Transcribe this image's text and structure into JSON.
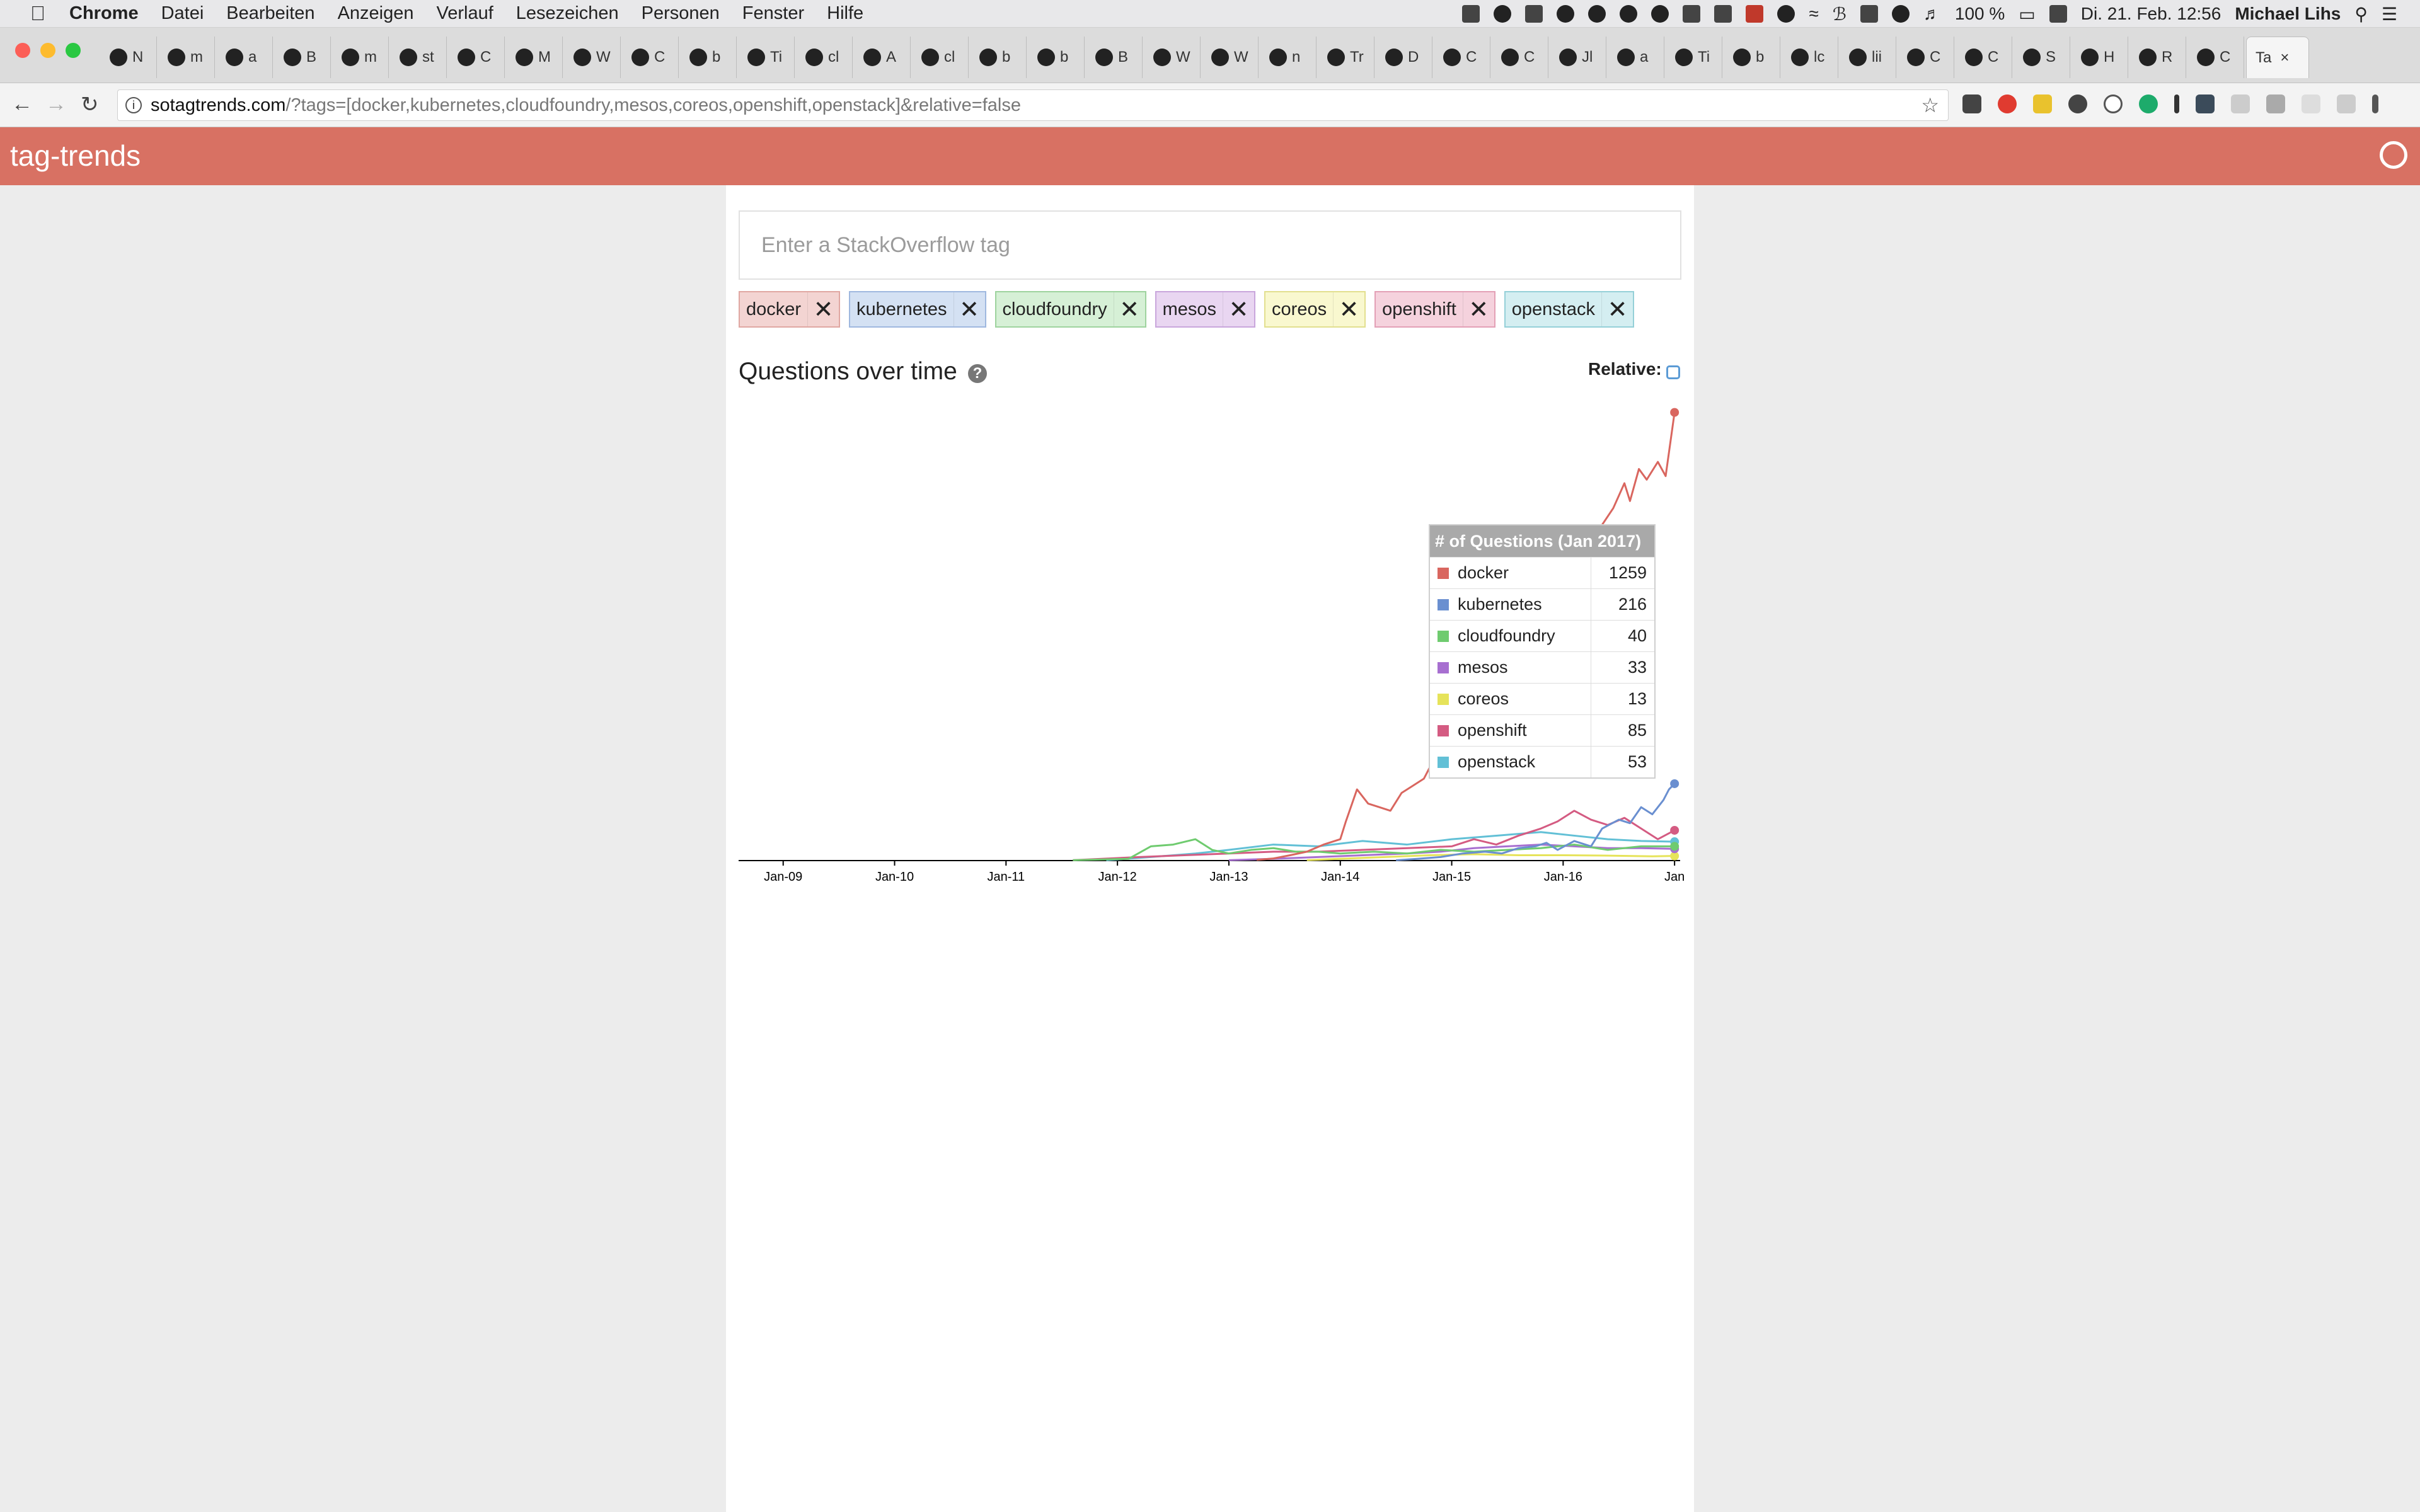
{
  "menubar": {
    "apple": "",
    "app": "Chrome",
    "items": [
      "Datei",
      "Bearbeiten",
      "Anzeigen",
      "Verlauf",
      "Lesezeichen",
      "Personen",
      "Fenster",
      "Hilfe"
    ],
    "battery": "100 %",
    "datetime": "Di. 21. Feb. 12:56",
    "user": "Michael Lihs"
  },
  "tabs": [
    "N",
    "m",
    "a",
    "B",
    "m",
    "st",
    "C",
    "M",
    "W",
    "C",
    "b",
    "Ti",
    "cl",
    "A",
    "cl",
    "b",
    "b",
    "B",
    "W",
    "W",
    "n",
    "Tr",
    "D",
    "C",
    "C",
    "Jl",
    "a",
    "Ti",
    "b",
    "lc",
    "lii",
    "C",
    "C",
    "S",
    "H",
    "R",
    "C"
  ],
  "active_tab": "Ta",
  "url": {
    "host": "sotagtrends.com",
    "path": "/?tags=[docker,kubernetes,cloudfoundry,mesos,coreos,openshift,openstack]&relative=false"
  },
  "app": {
    "brand": "tag-trends",
    "search_placeholder": "Enter a StackOverflow tag"
  },
  "tags": [
    {
      "name": "docker",
      "bg": "#f3d4d2",
      "border": "#e0a7a2"
    },
    {
      "name": "kubernetes",
      "bg": "#d4e1f3",
      "border": "#9fb8df"
    },
    {
      "name": "cloudfoundry",
      "bg": "#d6f0d6",
      "border": "#9ed39e"
    },
    {
      "name": "mesos",
      "bg": "#e9d6f1",
      "border": "#c9a6dc"
    },
    {
      "name": "coreos",
      "bg": "#f9f8cf",
      "border": "#e2df8f"
    },
    {
      "name": "openshift",
      "bg": "#f5d2dd",
      "border": "#e3a0b6"
    },
    {
      "name": "openstack",
      "bg": "#d4eef1",
      "border": "#95d0d8"
    }
  ],
  "chart_title": "Questions over time",
  "relative_label": "Relative:",
  "tooltip": {
    "title": "# of Questions (Jan 2017)"
  },
  "chart_data": {
    "type": "line",
    "x_ticks": [
      "Jan-09",
      "Jan-10",
      "Jan-11",
      "Jan-12",
      "Jan-13",
      "Jan-14",
      "Jan-15",
      "Jan-16",
      "Jan"
    ],
    "x_range": [
      2008.6,
      2017.05
    ],
    "y_range": [
      0,
      1260
    ],
    "series": [
      {
        "name": "docker",
        "color": "#d9665f",
        "points": [
          [
            2013.25,
            2
          ],
          [
            2013.4,
            6
          ],
          [
            2013.55,
            15
          ],
          [
            2013.7,
            25
          ],
          [
            2013.85,
            45
          ],
          [
            2014.0,
            60
          ],
          [
            2014.05,
            110
          ],
          [
            2014.15,
            200
          ],
          [
            2014.25,
            160
          ],
          [
            2014.35,
            150
          ],
          [
            2014.45,
            140
          ],
          [
            2014.55,
            190
          ],
          [
            2014.65,
            210
          ],
          [
            2014.75,
            230
          ],
          [
            2014.85,
            290
          ],
          [
            2014.92,
            250
          ],
          [
            2015.0,
            330
          ],
          [
            2015.1,
            390
          ],
          [
            2015.2,
            470
          ],
          [
            2015.3,
            520
          ],
          [
            2015.4,
            590
          ],
          [
            2015.5,
            560
          ],
          [
            2015.6,
            580
          ],
          [
            2015.7,
            640
          ],
          [
            2015.8,
            700
          ],
          [
            2015.9,
            760
          ],
          [
            2016.0,
            820
          ],
          [
            2016.15,
            860
          ],
          [
            2016.3,
            920
          ],
          [
            2016.45,
            990
          ],
          [
            2016.55,
            1060
          ],
          [
            2016.6,
            1010
          ],
          [
            2016.68,
            1100
          ],
          [
            2016.75,
            1070
          ],
          [
            2016.85,
            1120
          ],
          [
            2016.92,
            1080
          ],
          [
            2017.0,
            1259
          ]
        ]
      },
      {
        "name": "kubernetes",
        "color": "#6a8fd0",
        "points": [
          [
            2014.5,
            1
          ],
          [
            2014.7,
            5
          ],
          [
            2014.9,
            10
          ],
          [
            2015.1,
            20
          ],
          [
            2015.3,
            25
          ],
          [
            2015.45,
            20
          ],
          [
            2015.6,
            35
          ],
          [
            2015.75,
            40
          ],
          [
            2015.85,
            50
          ],
          [
            2015.95,
            30
          ],
          [
            2016.1,
            55
          ],
          [
            2016.25,
            40
          ],
          [
            2016.35,
            90
          ],
          [
            2016.5,
            115
          ],
          [
            2016.6,
            105
          ],
          [
            2016.7,
            150
          ],
          [
            2016.8,
            130
          ],
          [
            2016.9,
            170
          ],
          [
            2016.95,
            200
          ],
          [
            2017.0,
            216
          ]
        ]
      },
      {
        "name": "cloudfoundry",
        "color": "#6fcb6f",
        "points": [
          [
            2011.6,
            1
          ],
          [
            2012.1,
            5
          ],
          [
            2012.3,
            40
          ],
          [
            2012.5,
            45
          ],
          [
            2012.7,
            60
          ],
          [
            2012.85,
            30
          ],
          [
            2013.0,
            20
          ],
          [
            2013.2,
            30
          ],
          [
            2013.4,
            35
          ],
          [
            2013.6,
            25
          ],
          [
            2013.8,
            25
          ],
          [
            2014.0,
            20
          ],
          [
            2014.3,
            25
          ],
          [
            2014.6,
            20
          ],
          [
            2014.9,
            30
          ],
          [
            2015.2,
            25
          ],
          [
            2015.5,
            30
          ],
          [
            2015.8,
            35
          ],
          [
            2016.1,
            45
          ],
          [
            2016.4,
            30
          ],
          [
            2016.7,
            40
          ],
          [
            2017.0,
            40
          ]
        ]
      },
      {
        "name": "mesos",
        "color": "#a76fd0",
        "points": [
          [
            2013.0,
            1
          ],
          [
            2013.4,
            5
          ],
          [
            2013.8,
            10
          ],
          [
            2014.2,
            15
          ],
          [
            2014.6,
            20
          ],
          [
            2014.9,
            25
          ],
          [
            2015.2,
            35
          ],
          [
            2015.5,
            40
          ],
          [
            2015.8,
            45
          ],
          [
            2016.1,
            40
          ],
          [
            2016.4,
            35
          ],
          [
            2016.7,
            35
          ],
          [
            2017.0,
            33
          ]
        ]
      },
      {
        "name": "coreos",
        "color": "#e6e35a",
        "points": [
          [
            2013.7,
            1
          ],
          [
            2014.0,
            5
          ],
          [
            2014.4,
            10
          ],
          [
            2014.8,
            15
          ],
          [
            2015.2,
            18
          ],
          [
            2015.6,
            15
          ],
          [
            2016.0,
            15
          ],
          [
            2016.4,
            14
          ],
          [
            2016.8,
            12
          ],
          [
            2017.0,
            13
          ]
        ]
      },
      {
        "name": "openshift",
        "color": "#d45b82",
        "points": [
          [
            2011.6,
            1
          ],
          [
            2012.2,
            10
          ],
          [
            2012.6,
            15
          ],
          [
            2013.0,
            20
          ],
          [
            2013.4,
            25
          ],
          [
            2013.8,
            25
          ],
          [
            2014.2,
            30
          ],
          [
            2014.6,
            35
          ],
          [
            2015.0,
            40
          ],
          [
            2015.2,
            60
          ],
          [
            2015.4,
            45
          ],
          [
            2015.6,
            70
          ],
          [
            2015.8,
            90
          ],
          [
            2015.95,
            110
          ],
          [
            2016.1,
            140
          ],
          [
            2016.25,
            115
          ],
          [
            2016.4,
            100
          ],
          [
            2016.55,
            120
          ],
          [
            2016.7,
            90
          ],
          [
            2016.85,
            60
          ],
          [
            2017.0,
            85
          ]
        ]
      },
      {
        "name": "openstack",
        "color": "#62c0d6",
        "points": [
          [
            2011.9,
            1
          ],
          [
            2012.3,
            10
          ],
          [
            2012.7,
            20
          ],
          [
            2013.0,
            30
          ],
          [
            2013.4,
            45
          ],
          [
            2013.8,
            40
          ],
          [
            2014.2,
            55
          ],
          [
            2014.6,
            45
          ],
          [
            2015.0,
            60
          ],
          [
            2015.4,
            70
          ],
          [
            2015.8,
            80
          ],
          [
            2016.1,
            70
          ],
          [
            2016.4,
            60
          ],
          [
            2016.7,
            55
          ],
          [
            2017.0,
            53
          ]
        ]
      }
    ],
    "values_at_tooltip": [
      1259,
      216,
      40,
      33,
      13,
      85,
      53
    ]
  }
}
